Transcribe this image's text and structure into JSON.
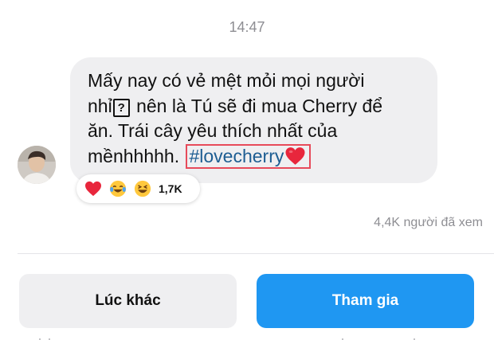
{
  "chat": {
    "timestamp": "14:47",
    "message": {
      "line1": "Mấy nay có vẻ mệt mỏi mọi người",
      "line2_before": "nhỉ",
      "line2_symbol": "?",
      "line2_after": " nên là Tú sẽ đi mua Cherry để",
      "line3": "ăn. Trái cây yêu thích nhất của",
      "line4_before": "mềnhhhhh. ",
      "hashtag": "#lovecherry",
      "hashtag_highlight_color": "#e74a5a",
      "hashtag_color": "#1d5d92"
    },
    "reactions": {
      "icons": [
        "heart-icon",
        "joy-emoji-icon",
        "laughing-emoji-icon"
      ],
      "count": "1,7K"
    },
    "views": "4,4K người đã xem"
  },
  "actions": {
    "later_label": "Lúc khác",
    "join_label": "Tham gia",
    "join_color": "#1f97f2"
  }
}
